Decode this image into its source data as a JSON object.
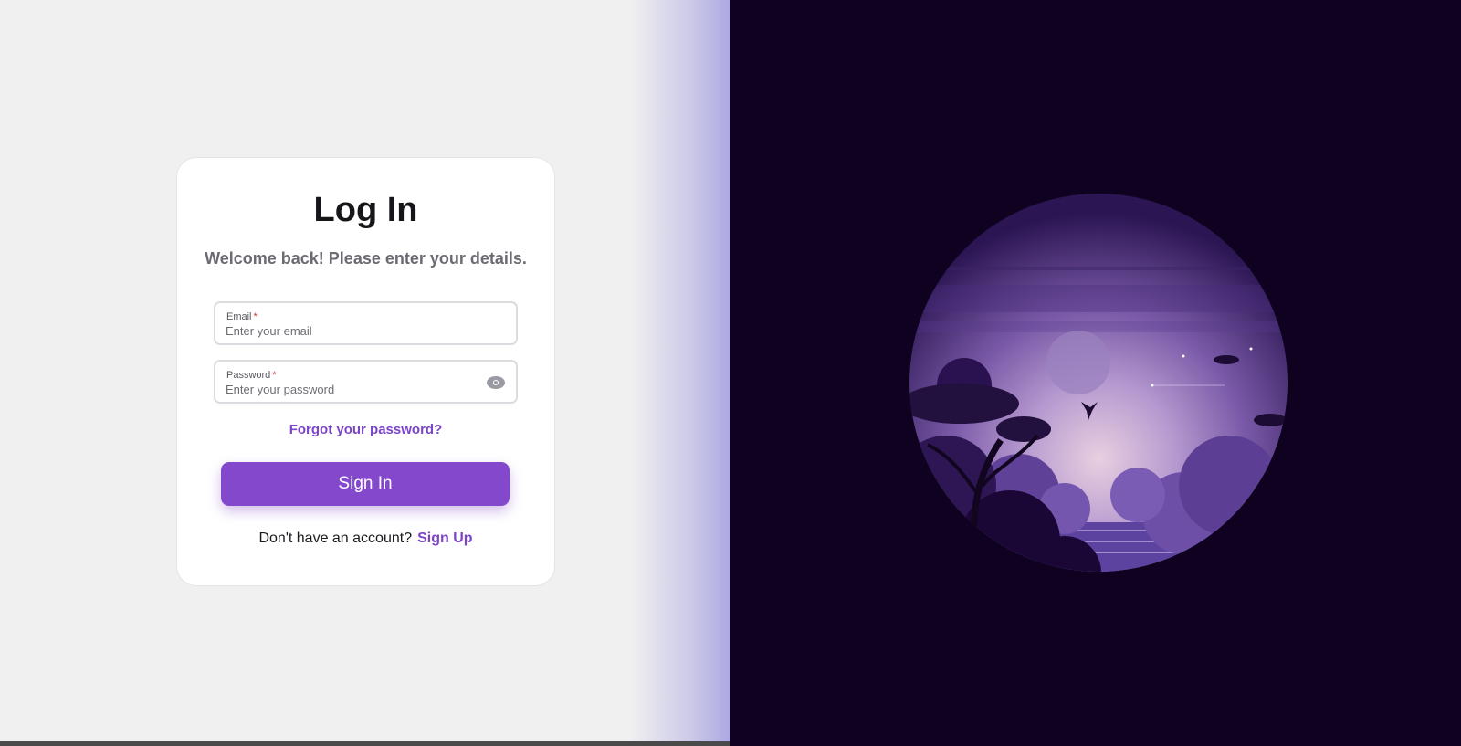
{
  "login": {
    "title": "Log In",
    "subtitle": "Welcome back! Please enter your details.",
    "email": {
      "label": "Email",
      "required_mark": "*",
      "placeholder": "Enter your email"
    },
    "password": {
      "label": "Password",
      "required_mark": "*",
      "placeholder": "Enter your password",
      "toggle_icon": "eye-icon"
    },
    "forgot_link": "Forgot your password?",
    "submit_label": "Sign In",
    "signup_prompt": "Don't have an account?",
    "signup_link": "Sign Up"
  },
  "illustration": {
    "description_icon": "night-landscape-illustration"
  },
  "colors": {
    "accent": "#8448cc",
    "link": "#7c45c7",
    "background": "#f0f0f0",
    "night": "#0e0220"
  }
}
